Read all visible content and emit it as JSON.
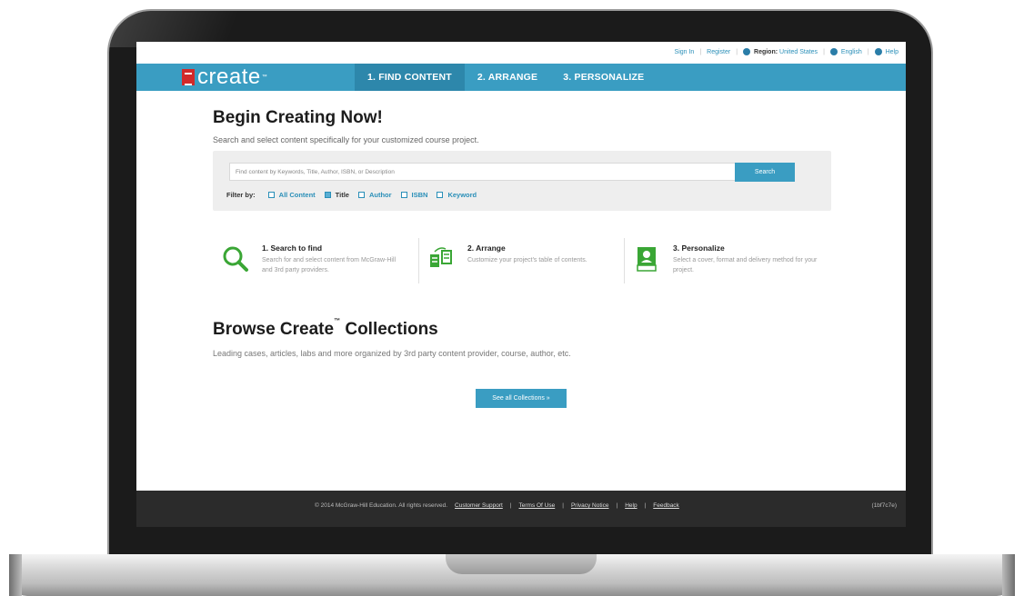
{
  "util_bar": {
    "sign_in": "Sign In",
    "register": "Register",
    "region_label": "Region:",
    "region_value": "United States",
    "language": "English",
    "help": "Help"
  },
  "logo": {
    "text": "create",
    "tm": "™"
  },
  "nav": {
    "tabs": [
      {
        "label": "1. FIND CONTENT",
        "active": true
      },
      {
        "label": "2. ARRANGE",
        "active": false
      },
      {
        "label": "3. PERSONALIZE",
        "active": false
      }
    ]
  },
  "main": {
    "title": "Begin Creating Now!",
    "subtitle": "Search and select content specifically for your customized course project.",
    "search": {
      "placeholder": "Find content by Keywords, Title, Author, ISBN, or Description",
      "button": "Search"
    },
    "filter": {
      "label": "Filter by:",
      "items": [
        {
          "label": "All Content",
          "checked": false
        },
        {
          "label": "Title",
          "checked": true
        },
        {
          "label": "Author",
          "checked": false
        },
        {
          "label": "ISBN",
          "checked": false
        },
        {
          "label": "Keyword",
          "checked": false
        }
      ]
    }
  },
  "steps": [
    {
      "icon": "magnifier-icon",
      "title": "1. Search to find",
      "desc": "Search for and select content from McGraw-Hill and 3rd party providers."
    },
    {
      "icon": "arrange-icon",
      "title": "2. Arrange",
      "desc": "Customize your project's table of contents."
    },
    {
      "icon": "book-icon",
      "title": "3. Personalize",
      "desc": "Select a cover, format and delivery method for your project."
    }
  ],
  "browse": {
    "title": "Browse Create",
    "tm": "™",
    "title_suffix": "Collections",
    "subtitle": "Leading cases, articles, labs and more organized by 3rd party content provider, course, author, etc.",
    "button": "See all Collections »"
  },
  "footer": {
    "copyright": "© 2014 McGraw-Hill Education. All rights reserved.",
    "links": [
      "Customer Support",
      "Terms Of Use",
      "Privacy Notice",
      "Help",
      "Feedback"
    ],
    "code": "(1bf7c7e)"
  },
  "colors": {
    "accent": "#3a9dc2",
    "accent_dark": "#2d87ab",
    "logo_red": "#d12a2a",
    "icon_green": "#3aa635",
    "footer_bg": "#2b2b2b"
  }
}
